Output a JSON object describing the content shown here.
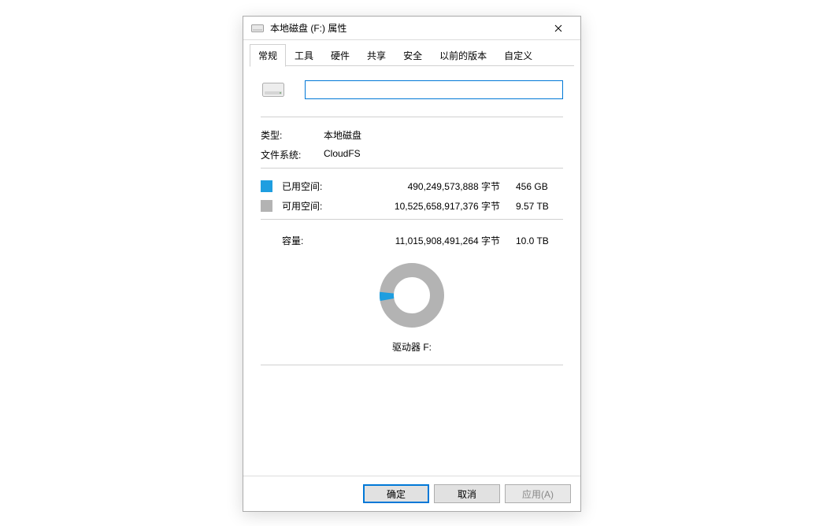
{
  "titlebar": {
    "text": "本地磁盘 (F:) 属性"
  },
  "tabs": [
    "常规",
    "工具",
    "硬件",
    "共享",
    "安全",
    "以前的版本",
    "自定义"
  ],
  "name_input_value": "",
  "type_row": {
    "label": "类型:",
    "value": "本地磁盘"
  },
  "fs_row": {
    "label": "文件系统:",
    "value": "CloudFS"
  },
  "used": {
    "label": "已用空间:",
    "bytes": "490,249,573,888 字节",
    "human": "456 GB"
  },
  "free": {
    "label": "可用空间:",
    "bytes": "10,525,658,917,376 字节",
    "human": "9.57 TB"
  },
  "capacity": {
    "label": "容量:",
    "bytes": "11,015,908,491,264 字节",
    "human": "10.0 TB"
  },
  "drive_label": "驱动器 F:",
  "buttons": {
    "ok": "确定",
    "cancel": "取消",
    "apply": "应用(A)"
  },
  "colors": {
    "used": "#1e9ee0",
    "free": "#b3b3b3"
  },
  "donut": {
    "used_fraction": 0.0445
  }
}
